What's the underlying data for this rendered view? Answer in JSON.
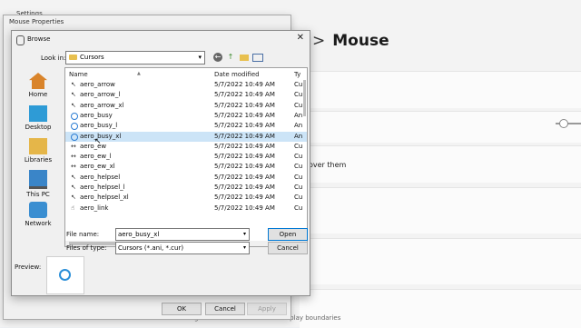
{
  "settings": {
    "title": "Settings",
    "breadcrumb_chevron": ">",
    "page_title": "Mouse",
    "hover_text": "over them",
    "boundaries_text": "Change how cursor moves over display boundaries"
  },
  "mouse_properties": {
    "title": "Mouse Properties",
    "ok_label": "OK",
    "cancel_label": "Cancel",
    "apply_label": "Apply"
  },
  "browse": {
    "title": "Browse",
    "close_glyph": "✕",
    "look_in_label": "Look in:",
    "look_in_value": "Cursors",
    "places": [
      "Home",
      "Desktop",
      "Libraries",
      "This PC",
      "Network"
    ],
    "columns": {
      "name": "Name",
      "date": "Date modified",
      "type": "Ty"
    },
    "files": [
      {
        "name": "aero_arrow",
        "date": "5/7/2022 10:49 AM",
        "type": "Cu",
        "icon": "arrow-cursor-icon"
      },
      {
        "name": "aero_arrow_l",
        "date": "5/7/2022 10:49 AM",
        "type": "Cu",
        "icon": "arrow-cursor-icon"
      },
      {
        "name": "aero_arrow_xl",
        "date": "5/7/2022 10:49 AM",
        "type": "Cu",
        "icon": "arrow-cursor-icon"
      },
      {
        "name": "aero_busy",
        "date": "5/7/2022 10:49 AM",
        "type": "An",
        "icon": "busy-cursor-icon"
      },
      {
        "name": "aero_busy_l",
        "date": "5/7/2022 10:49 AM",
        "type": "An",
        "icon": "busy-cursor-icon"
      },
      {
        "name": "aero_busy_xl",
        "date": "5/7/2022 10:49 AM",
        "type": "An",
        "icon": "busy-cursor-icon"
      },
      {
        "name": "aero_ew",
        "date": "5/7/2022 10:49 AM",
        "type": "Cu",
        "icon": "resize-ew-cursor-icon"
      },
      {
        "name": "aero_ew_l",
        "date": "5/7/2022 10:49 AM",
        "type": "Cu",
        "icon": "resize-ew-cursor-icon"
      },
      {
        "name": "aero_ew_xl",
        "date": "5/7/2022 10:49 AM",
        "type": "Cu",
        "icon": "resize-ew-cursor-icon"
      },
      {
        "name": "aero_helpsel",
        "date": "5/7/2022 10:49 AM",
        "type": "Cu",
        "icon": "help-cursor-icon"
      },
      {
        "name": "aero_helpsel_l",
        "date": "5/7/2022 10:49 AM",
        "type": "Cu",
        "icon": "help-cursor-icon"
      },
      {
        "name": "aero_helpsel_xl",
        "date": "5/7/2022 10:49 AM",
        "type": "Cu",
        "icon": "help-cursor-icon"
      },
      {
        "name": "aero_link",
        "date": "5/7/2022 10:49 AM",
        "type": "Cu",
        "icon": "link-cursor-icon"
      }
    ],
    "selected_file": "aero_busy_xl",
    "file_name_label": "File name:",
    "file_name_value": "aero_busy_xl",
    "files_of_type_label": "Files of type:",
    "files_of_type_value": "Cursors (*.ani, *.cur)",
    "open_label": "Open",
    "cancel_label": "Cancel",
    "preview_label": "Preview:"
  },
  "colors": {
    "selection": "#cce4f7",
    "accent": "#0078d4",
    "busy_ring": "#2b8fd8"
  }
}
